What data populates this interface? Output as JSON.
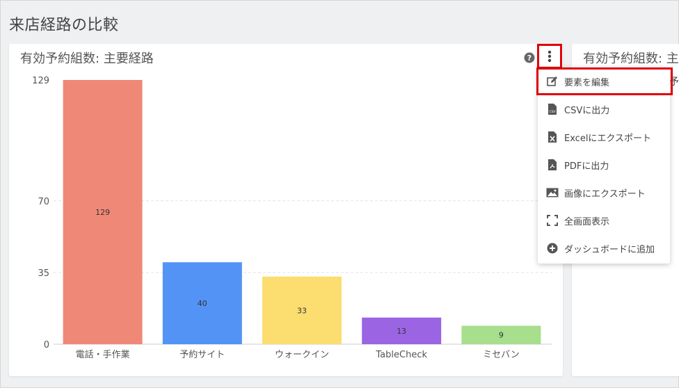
{
  "page_title": "来店経路の比較",
  "card": {
    "title": "有効予約組数: 主要経路"
  },
  "card2": {
    "title": "有効予約組数: 主",
    "sub": "予"
  },
  "menu": {
    "items": [
      {
        "label": "要素を編集",
        "icon": "edit-icon"
      },
      {
        "label": "CSVに出力",
        "icon": "csv-file-icon"
      },
      {
        "label": "Excelにエクスポート",
        "icon": "excel-file-icon"
      },
      {
        "label": "PDFに出力",
        "icon": "pdf-file-icon"
      },
      {
        "label": "画像にエクスポート",
        "icon": "image-icon"
      },
      {
        "label": "全画面表示",
        "icon": "fullscreen-icon"
      },
      {
        "label": "ダッシュボードに追加",
        "icon": "plus-circle-icon"
      }
    ]
  },
  "chart_data": {
    "type": "bar",
    "categories": [
      "電話・手作業",
      "予約サイト",
      "ウォークイン",
      "TableCheck",
      "ミセバン"
    ],
    "values": [
      129,
      40,
      33,
      13,
      9
    ],
    "colors": [
      "#f08878",
      "#5393f5",
      "#fbdd70",
      "#9b64e3",
      "#a7df8d"
    ],
    "yticks": [
      "129",
      "70",
      "35",
      "0"
    ],
    "ylim": [
      0,
      129
    ],
    "grid": true
  }
}
